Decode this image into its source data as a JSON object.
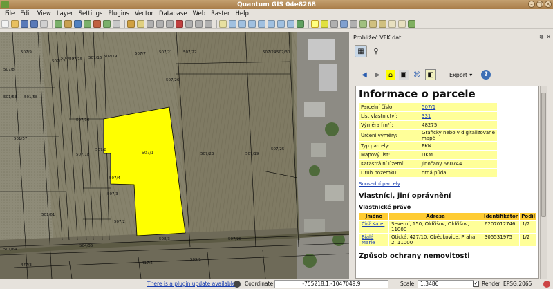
{
  "window": {
    "title": "Quantum GIS 04e8268"
  },
  "menu": [
    "File",
    "Edit",
    "View",
    "Layer",
    "Settings",
    "Plugins",
    "Vector",
    "Database",
    "Web",
    "Raster",
    "Help"
  ],
  "map": {
    "parcel_label": "507/1",
    "labels": [
      {
        "t": "507/8"
      },
      {
        "t": "507/9"
      },
      {
        "t": "507/12"
      },
      {
        "t": "507/13"
      },
      {
        "t": "507/15"
      },
      {
        "t": "507/16"
      },
      {
        "t": "507/19"
      },
      {
        "t": "507/7"
      },
      {
        "t": "507/21"
      },
      {
        "t": "507/22"
      },
      {
        "t": "507/24"
      },
      {
        "t": "507/30"
      },
      {
        "t": "501/58"
      },
      {
        "t": "501/57"
      },
      {
        "t": "507/26"
      },
      {
        "t": "507/23"
      },
      {
        "t": "507/19"
      },
      {
        "t": "507/25"
      },
      {
        "t": "507/8"
      },
      {
        "t": "507/3"
      },
      {
        "t": "507/2"
      },
      {
        "t": "507/4"
      },
      {
        "t": "501/61"
      },
      {
        "t": "501/64"
      },
      {
        "t": "507/14"
      },
      {
        "t": "507/18"
      },
      {
        "t": "508/3"
      },
      {
        "t": "477/3"
      },
      {
        "t": "417/5"
      },
      {
        "t": "504/35"
      },
      {
        "t": "507/28"
      },
      {
        "t": "509/1"
      },
      {
        "t": "501/53"
      }
    ]
  },
  "dock": {
    "title": "Prohlížeč VFK dat",
    "export_label": "Export",
    "heading": "Informace o parcele",
    "fields": [
      {
        "key": "Parcelní číslo:",
        "value": "507/1",
        "link": true
      },
      {
        "key": "List vlastnictví:",
        "value": "331",
        "link": true
      },
      {
        "key": "Výměra [m²]:",
        "value": "48275",
        "link": false
      },
      {
        "key": "Určení výměry:",
        "value": "Graficky nebo v digitalizované mapě",
        "link": false
      },
      {
        "key": "Typ parcely:",
        "value": "PKN",
        "link": false
      },
      {
        "key": "Mapový list:",
        "value": "DKM",
        "link": false
      },
      {
        "key": "Katastrální území:",
        "value": "Jinočany 660744",
        "link": false
      },
      {
        "key": "Druh pozemku:",
        "value": "orná půda",
        "link": false
      }
    ],
    "neighbors_link": "Sousední parcely",
    "owners_heading": "Vlastníci, jiní oprávnění",
    "ownership_heading": "Vlastnické právo",
    "owners_columns": [
      "Jméno",
      "Adresa",
      "Identifikátor",
      "Podíl"
    ],
    "owners": [
      {
        "name": "Čirž Karel",
        "address": "Severní, 150, Oldřišov, Oldřišov, 11000",
        "id": "6207012746",
        "share": "1/2"
      },
      {
        "name": "Bialá Marie",
        "address": "Otická, 427/10, Obědkovice, Praha 2, 11000",
        "id": "305531975",
        "share": "1/2"
      }
    ],
    "protection_heading": "Způsob ochrany nemovitosti"
  },
  "status": {
    "plugin_update": "There is a plugin update available",
    "coord_label": "Coordinate:",
    "coordinate": "-755218.1,-1047049.9",
    "scale_label": "Scale",
    "scale": "1:3486",
    "render_label": "Render",
    "epsg": "EPSG:2065"
  },
  "colors": {
    "parcel_fill": "#ffff00",
    "highlight_row": "#ffff99",
    "header_row": "#ffcc33"
  }
}
